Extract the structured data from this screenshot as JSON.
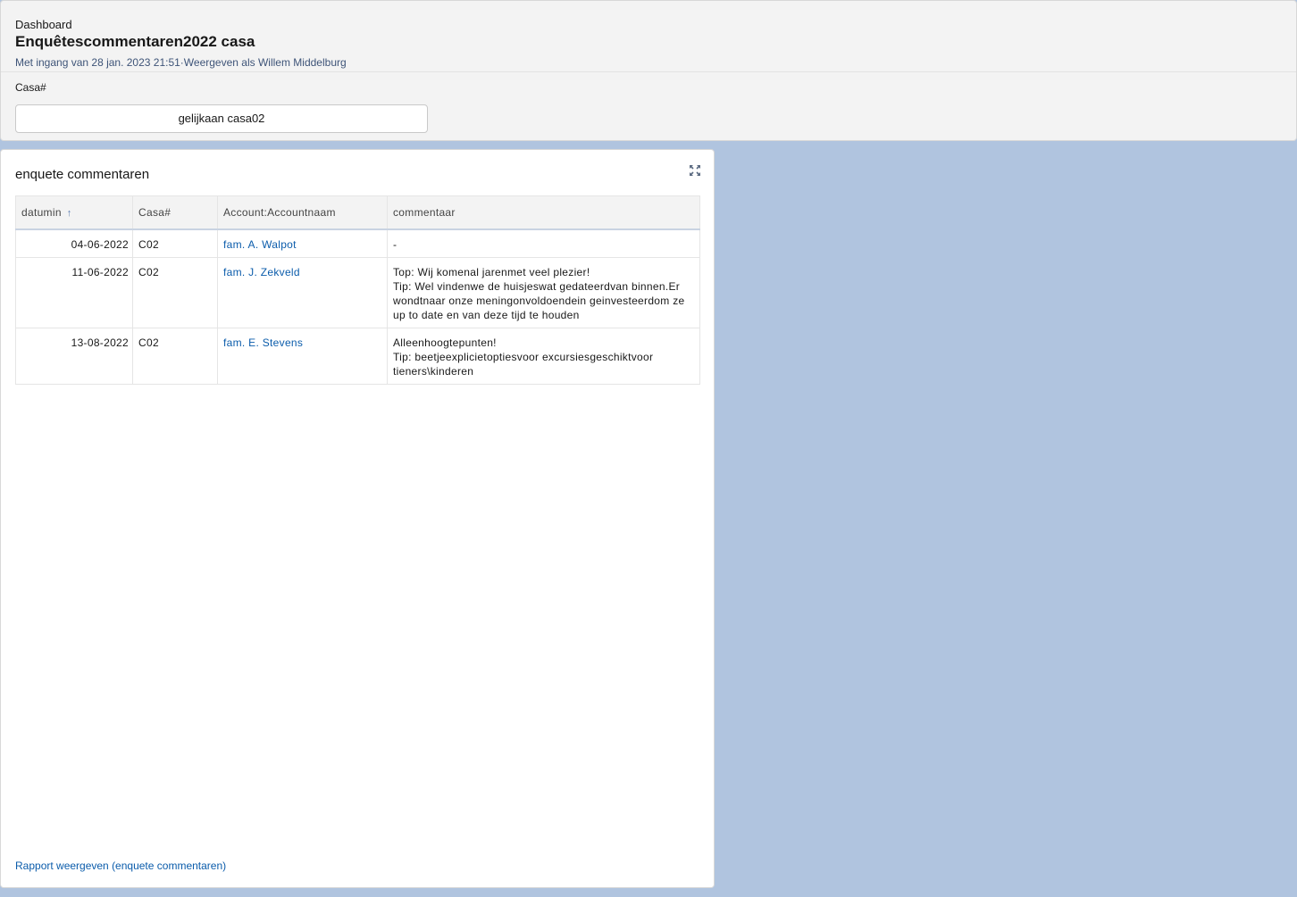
{
  "header": {
    "eyebrow": "Dashboard",
    "title": "Enquêtescommentaren2022 casa",
    "subtitle": "Met ingang van 28 jan. 2023 21:51·Weergeven als Willem Middelburg"
  },
  "filter": {
    "label": "Casa#",
    "value": "gelijkaan casa02"
  },
  "card": {
    "title": "enquete commentaren",
    "expand_icon": "expand-icon",
    "footer_link": "Rapport weergeven (enquete commentaren)"
  },
  "table": {
    "columns": [
      "datumin",
      "Casa#",
      "Account:Accountnaam",
      "commentaar"
    ],
    "sort_icon": "↑",
    "rows": [
      {
        "date": "04-06-2022",
        "casa": "C02",
        "account": "fam. A. Walpot",
        "comment": [
          "-"
        ]
      },
      {
        "date": "11-06-2022",
        "casa": "C02",
        "account": "fam. J. Zekveld",
        "comment": [
          "Top: Wij komenal jarenmet veel plezier!",
          "Tip: Wel vindenwe de huisjeswat gedateerdvan binnen.Er wondtnaar onze meningonvoldoendein geinvesteerdom ze up to date en van deze tijd te houden"
        ]
      },
      {
        "date": "13-08-2022",
        "casa": "C02",
        "account": "fam. E. Stevens",
        "comment": [
          "Alleenhoogtepunten!",
          "Tip: beetjeexplicietoptiesvoor excursiesgeschiktvoor tieners\\kinderen"
        ]
      }
    ]
  }
}
